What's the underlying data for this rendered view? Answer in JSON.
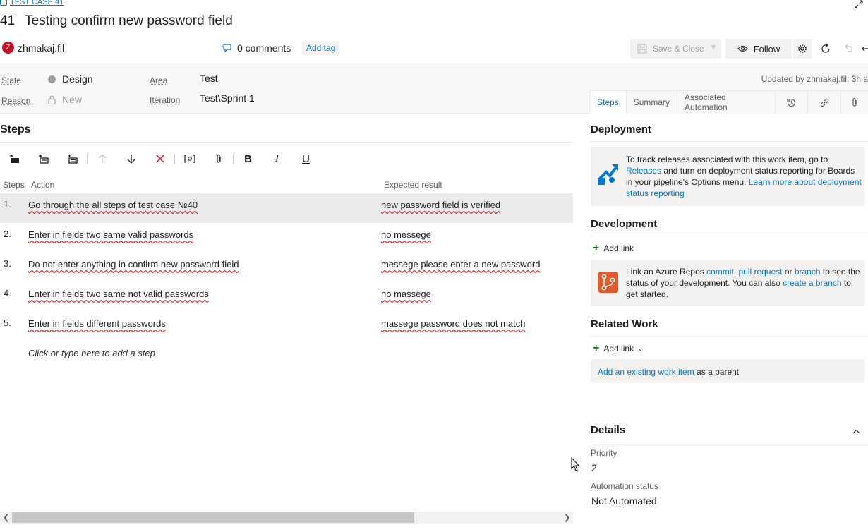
{
  "header": {
    "breadcrumb": "TEST CASE 41",
    "id": "41",
    "title": "Testing confirm new password field",
    "user_initial": "Z",
    "user": "zhmakaj.fil",
    "comments": "0 comments",
    "add_tag": "Add tag",
    "save_close": "Save & Close",
    "follow": "Follow",
    "updated": "Updated by zhmakaj.fil: 3h a"
  },
  "fields": {
    "state_label": "State",
    "state_value": "Design",
    "state_color": "#a19f9d",
    "reason_label": "Reason",
    "reason_value": "New",
    "area_label": "Area",
    "area_value": "Test",
    "iteration_label": "Iteration",
    "iteration_value": "Test\\Sprint 1"
  },
  "tabs": [
    "Steps",
    "Summary",
    "Associated Automation"
  ],
  "steps": {
    "heading": "Steps",
    "col_steps": "Steps",
    "col_action": "Action",
    "col_expected": "Expected result",
    "rows": [
      {
        "num": "1.",
        "action": "Go through the all steps of test case №40",
        "expected": "new password field is verified"
      },
      {
        "num": "2.",
        "action": "Enter in fields two same valid passwords",
        "expected": "no messege"
      },
      {
        "num": "3.",
        "action": "Do not enter anything in confirm new password field",
        "expected": "messege please enter a new password"
      },
      {
        "num": "4.",
        "action": "Enter in fields two same not valid passwords",
        "expected": "no massege"
      },
      {
        "num": "5.",
        "action": "Enter in fields different passwords",
        "expected": "massege password does not match"
      }
    ],
    "add_step": "Click or type here to add a step"
  },
  "deployment": {
    "heading": "Deployment",
    "text1": "To track releases associated with this work item, go to",
    "link1": "Releases",
    "text2": "and turn on deployment status reporting for Boards in your pipeline's Options menu.",
    "link2": "Learn more about deployment status reporting"
  },
  "development": {
    "heading": "Development",
    "add_link": "Add link",
    "t1": "Link an Azure Repos",
    "l1": "commit",
    "l2": "pull request",
    "t2": "or",
    "l3": "branch",
    "t3": "to see the status of your development. You can also",
    "l4": "create a branch",
    "t4": "to get started."
  },
  "related": {
    "heading": "Related Work",
    "add_link": "Add link",
    "existing_link": "Add an existing work item",
    "existing_text": "as a parent"
  },
  "details": {
    "heading": "Details",
    "priority_label": "Priority",
    "priority_value": "2",
    "automation_label": "Automation status",
    "automation_value": "Not Automated"
  },
  "colors": {
    "accent": "#0078d4",
    "avatar": "#c50f1f",
    "spell_error": "#d13438",
    "add_green": "#107c10"
  }
}
